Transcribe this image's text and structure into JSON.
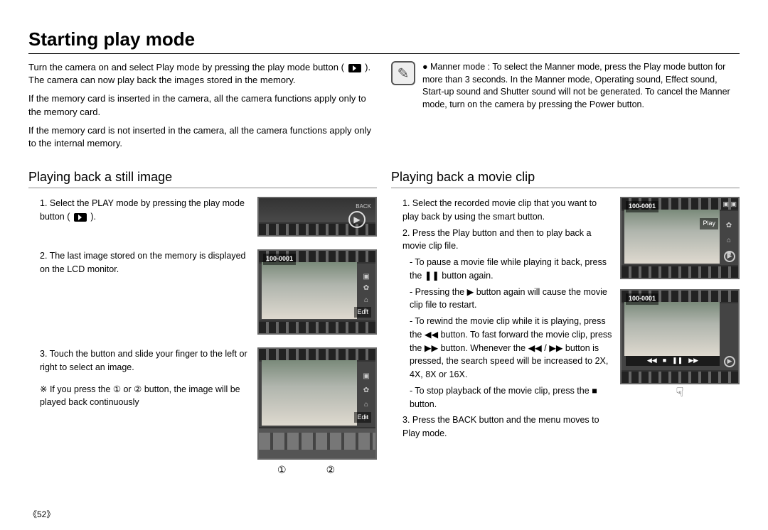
{
  "page_title": "Starting play mode",
  "page_number": "《52》",
  "intro": {
    "p1a": "Turn the camera on and select Play mode by pressing the play mode button ( ",
    "p1b": " ). The camera can now play back the images stored in the memory.",
    "p2": "If the memory card is inserted in the camera, all the camera functions apply only to the memory card.",
    "p3": "If the memory card is not inserted in the camera, all the camera functions apply only to the internal memory."
  },
  "note": {
    "bullet": "●",
    "label": "Manner mode :",
    "text": "To select the Manner mode, press the Play mode button for more than 3 seconds. In the Manner mode, Operating sound, Effect sound, Start-up sound and Shutter sound will not be generated. To cancel the Manner mode, turn on the camera by pressing the Power button."
  },
  "still": {
    "title": "Playing back a still image",
    "s1a": "1. Select the PLAY mode by pressing the play mode button ( ",
    "s1b": " ).",
    "s2": "2. The last image stored on the memory is displayed on the LCD monitor.",
    "s3": "3. Touch the button and slide your finger to the left or right to select an image.",
    "s3note_a": "※ If you press the ① or ② button, the image will be played back continuously",
    "num1": "①",
    "num2": "②",
    "img_folder": "100-0001",
    "img_edit": "Edit",
    "back": "BACK"
  },
  "movie": {
    "title": "Playing back a movie clip",
    "s1": "1. Select the recorded movie clip that you want to play back by using the smart button.",
    "s2": "2. Press the Play button and then to play back a movie clip file.",
    "s2a_a": "- To pause a movie file while playing it back, press the ",
    "s2a_b": " button again.",
    "s2b_a": "- Pressing the ",
    "s2b_b": " button again will cause the movie clip file to restart.",
    "s2c_a": "- To rewind the movie clip while it is playing, press the ",
    "s2c_b": " button. To fast forward the movie clip, press the ",
    "s2c_c": " button. Whenever the ",
    "s2c_d": " / ",
    "s2c_e": " button is pressed, the search speed will be increased to 2X, 4X, 8X or 16X.",
    "s2d_a": "- To stop playback of the movie clip, press the ",
    "s2d_b": " button.",
    "s3": "3. Press the BACK button and the menu moves to Play mode.",
    "img_folder": "100-0001",
    "play_label": "Play"
  },
  "glyphs": {
    "pause": "❚❚",
    "play": "▶",
    "rew": "◀◀",
    "ff": "▶▶",
    "stop": "■"
  }
}
